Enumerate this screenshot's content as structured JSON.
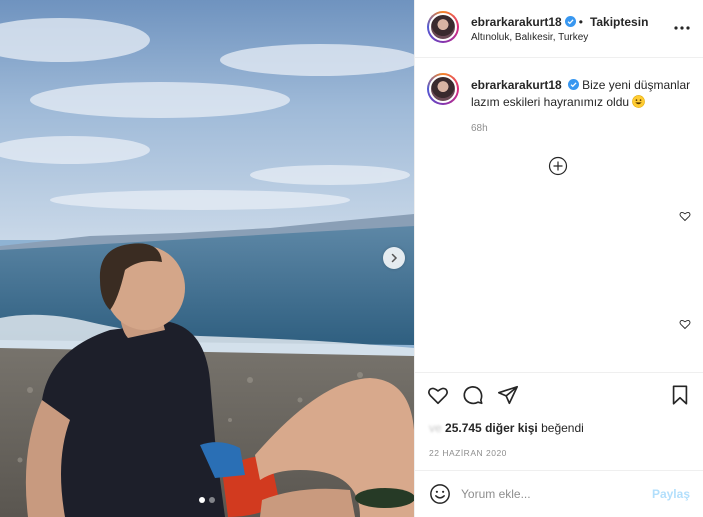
{
  "post": {
    "header": {
      "username": "ebrarkarakurt18",
      "verified": true,
      "separator": "•",
      "follow_label": "Takiptesin",
      "location": "Altınoluk, Balıkesir, Turkey",
      "more_icon": "more-horizontal-icon"
    },
    "caption": {
      "username": "ebrarkarakurt18",
      "text": "Bize yeni düşmanlar lazım eskileri hayranımız oldu",
      "emoji_icon": "grinning-face-emoji",
      "time_ago": "68h"
    },
    "carousel": {
      "dots": 2,
      "active_index": 0
    },
    "actions": {
      "like_icon": "heart-icon",
      "comment_icon": "comment-icon",
      "share_icon": "paper-plane-icon",
      "save_icon": "bookmark-icon"
    },
    "likes": {
      "blurred_prefix": "ve",
      "count_text": "25.745 diğer kişi",
      "suffix": "beğendi"
    },
    "date": "22 HAZİRAN 2020",
    "comment": {
      "placeholder": "Yorum ekle...",
      "post_label": "Paylaş"
    },
    "colors": {
      "verified_blue": "#3897f0",
      "post_button_disabled": "#b2dffc",
      "muted_text": "#8e8e8e"
    }
  }
}
